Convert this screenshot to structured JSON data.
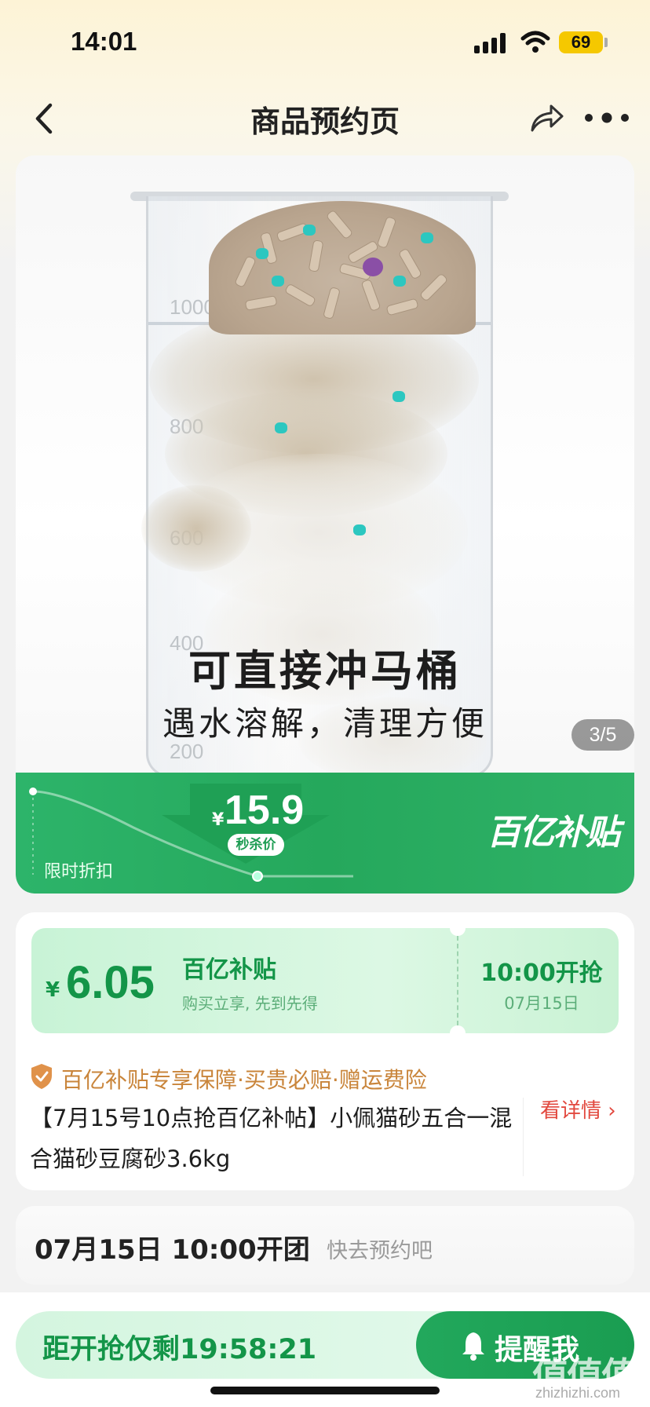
{
  "status_bar": {
    "time": "14:01",
    "battery": "69"
  },
  "nav": {
    "title": "商品预约页"
  },
  "gallery": {
    "headline": "可直接冲马桶",
    "subheadline": "遇水溶解，清理方便",
    "counter": "3/5",
    "scale_labels": [
      "1000",
      "800",
      "600",
      "400",
      "200"
    ]
  },
  "price_banner": {
    "limit_label": "限时折扣",
    "currency": "¥",
    "flash_price": "15.9",
    "flash_label": "秒杀价",
    "brand": "百亿补贴"
  },
  "coupon": {
    "currency": "¥",
    "amount": "6.05",
    "title": "百亿补贴",
    "desc": "购买立享, 先到先得",
    "time": "10:00开抢",
    "date": "07月15日"
  },
  "guarantee": {
    "text": "百亿补贴专享保障·买贵必赔·赠运费险"
  },
  "product": {
    "title": "【7月15号10点抢百亿补帖】小佩猫砂五合一混合猫砂豆腐砂3.6kg",
    "detail_link": "看详情"
  },
  "schedule": {
    "date": "07月15日  10:00开团",
    "hint": "快去预约吧"
  },
  "bottom": {
    "countdown": "距开抢仅剩19:58:21",
    "remind_label": "提醒我",
    "watermark": "值值值",
    "watermark_url": "zhizhizhi.com"
  },
  "colors": {
    "brand_green": "#25a85c",
    "coupon_text": "#139548",
    "guarantee": "#c9853b",
    "detail_link": "#e2483e"
  },
  "icons": [
    "back-icon",
    "share-icon",
    "more-icon",
    "shield-icon",
    "bell-icon",
    "signal-icon",
    "wifi-icon",
    "battery-icon"
  ]
}
